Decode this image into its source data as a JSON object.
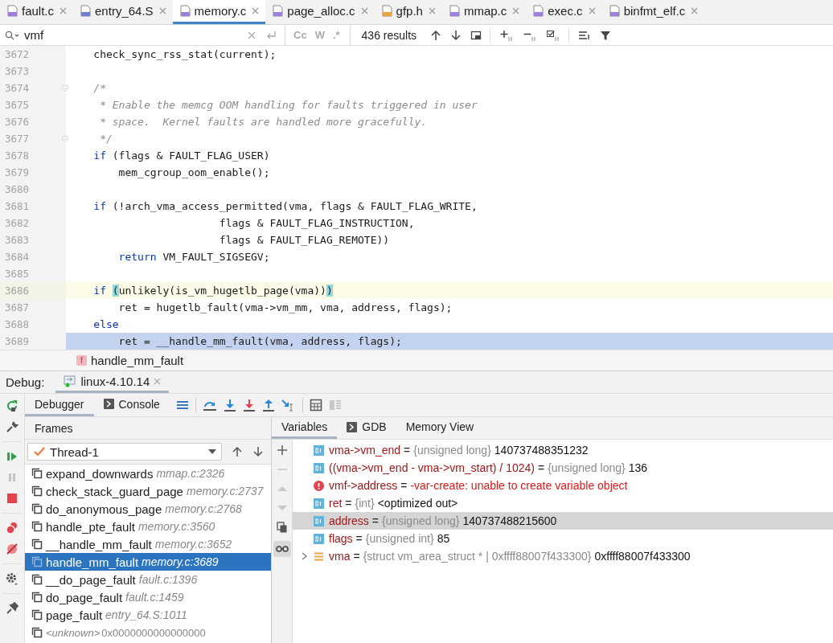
{
  "editor_tabs": [
    {
      "label": "fault.c",
      "kind": "c",
      "selected": false
    },
    {
      "label": "entry_64.S",
      "kind": "asm",
      "selected": false
    },
    {
      "label": "memory.c",
      "kind": "c",
      "selected": true
    },
    {
      "label": "page_alloc.c",
      "kind": "c",
      "selected": false
    },
    {
      "label": "gfp.h",
      "kind": "h",
      "selected": false
    },
    {
      "label": "mmap.c",
      "kind": "c",
      "selected": false
    },
    {
      "label": "exec.c",
      "kind": "c",
      "selected": false
    },
    {
      "label": "binfmt_elf.c",
      "kind": "c",
      "selected": false
    }
  ],
  "search": {
    "value": "vmf",
    "options": [
      {
        "label": "Cc",
        "selected": false
      },
      {
        "label": "W",
        "selected": false
      },
      {
        "label": ".*",
        "selected": false
      }
    ],
    "results": "436 results"
  },
  "code": {
    "lines": [
      {
        "number": "3672",
        "current": false,
        "executing": false,
        "segments": [
          {
            "kind": "plain",
            "text": "    check_sync_rss_stat(current);"
          }
        ]
      },
      {
        "number": "3673",
        "current": false,
        "executing": false
      },
      {
        "number": "3674",
        "current": false,
        "executing": false,
        "fold": true,
        "segments": [
          {
            "kind": "comment",
            "text": "    /*"
          }
        ]
      },
      {
        "number": "3675",
        "current": false,
        "executing": false,
        "segments": [
          {
            "kind": "comment",
            "text": "     * Enable the memcg OOM handling for faults triggered in user"
          }
        ]
      },
      {
        "number": "3676",
        "current": false,
        "executing": false,
        "segments": [
          {
            "kind": "comment",
            "text": "     * space.  Kernel faults are handled more gracefully."
          }
        ]
      },
      {
        "number": "3677",
        "current": false,
        "executing": false,
        "fold": true,
        "segments": [
          {
            "kind": "comment",
            "text": "     */"
          }
        ]
      },
      {
        "number": "3678",
        "current": false,
        "executing": false,
        "segments": [
          {
            "kind": "keyword",
            "text": "    if"
          },
          {
            "kind": "plain",
            "text": " (flags & FAULT_FLAG_USER)"
          }
        ]
      },
      {
        "number": "3679",
        "current": false,
        "executing": false,
        "segments": [
          {
            "kind": "plain",
            "text": "        mem_cgroup_oom_enable();"
          }
        ]
      },
      {
        "number": "3680",
        "current": false,
        "executing": false
      },
      {
        "number": "3681",
        "current": false,
        "executing": false,
        "segments": [
          {
            "kind": "keyword",
            "text": "    if"
          },
          {
            "kind": "plain",
            "text": " (!arch_vma_access_permitted(vma, flags & FAULT_FLAG_WRITE,"
          }
        ]
      },
      {
        "number": "3682",
        "current": false,
        "executing": false,
        "segments": [
          {
            "kind": "plain",
            "text": "                        flags & FAULT_FLAG_INSTRUCTION,"
          }
        ]
      },
      {
        "number": "3683",
        "current": false,
        "executing": false,
        "segments": [
          {
            "kind": "plain",
            "text": "                        flags & FAULT_FLAG_REMOTE))"
          }
        ]
      },
      {
        "number": "3684",
        "current": false,
        "executing": false,
        "segments": [
          {
            "kind": "keyword",
            "text": "        return"
          },
          {
            "kind": "plain",
            "text": " VM_FAULT_SIGSEGV;"
          }
        ]
      },
      {
        "number": "3685",
        "current": false,
        "executing": false
      },
      {
        "number": "3686",
        "current": true,
        "executing": false,
        "segments": [
          {
            "kind": "keyword",
            "text": "    if "
          },
          {
            "kind": "match",
            "text": "("
          },
          {
            "kind": "plain",
            "text": "unlikely(is_vm_hugetlb_page(vma))"
          },
          {
            "kind": "match",
            "text": ")"
          }
        ]
      },
      {
        "number": "3687",
        "current": false,
        "executing": false,
        "segments": [
          {
            "kind": "plain",
            "text": "        ret = hugetlb_fault(vma->vm_mm, vma, address, flags);"
          }
        ]
      },
      {
        "number": "3688",
        "current": false,
        "executing": false,
        "segments": [
          {
            "kind": "keyword",
            "text": "    else"
          }
        ]
      },
      {
        "number": "3689",
        "current": false,
        "executing": true,
        "segments": [
          {
            "kind": "plain",
            "text": "        ret = __handle_mm_fault(vma, address, flags);"
          }
        ]
      }
    ]
  },
  "breadcrumb": {
    "icon_letter": "f",
    "label": "handle_mm_fault"
  },
  "debug": {
    "label": "Debug:",
    "session": "linux-4.10.14",
    "tabs": [
      {
        "label": "Debugger",
        "selected": true
      },
      {
        "label": "Console",
        "selected": false
      }
    ],
    "frames": {
      "title": "Frames",
      "thread": "Thread-1",
      "items": [
        {
          "kind": "frame",
          "name": "expand_downwards",
          "location": "mmap.c:2326",
          "selected": false
        },
        {
          "kind": "frame",
          "name": "check_stack_guard_page",
          "location": "memory.c:2737",
          "selected": false
        },
        {
          "kind": "frame",
          "name": "do_anonymous_page",
          "location": "memory.c:2768",
          "selected": false
        },
        {
          "kind": "frame",
          "name": "handle_pte_fault",
          "location": "memory.c:3560",
          "selected": false
        },
        {
          "kind": "frame",
          "name": "__handle_mm_fault",
          "location": "memory.c:3652",
          "selected": false
        },
        {
          "kind": "frame",
          "name": "handle_mm_fault",
          "location": "memory.c:3689",
          "selected": true
        },
        {
          "kind": "frame",
          "name": "__do_page_fault",
          "location": "fault.c:1396",
          "selected": false
        },
        {
          "kind": "frame",
          "name": "do_page_fault",
          "location": "fault.c:1459",
          "selected": false
        },
        {
          "kind": "frame",
          "name": "page_fault",
          "location": "entry_64.S:1011",
          "selected": false
        },
        {
          "kind": "unknown",
          "name": "<unknown>",
          "location": "0x0000000000000000",
          "selected": false
        }
      ]
    },
    "variables": {
      "tabs": [
        {
          "label": "Variables",
          "selected": true
        },
        {
          "label": "GDB",
          "selected": false
        },
        {
          "label": "Memory View",
          "selected": false
        }
      ],
      "items": [
        {
          "kind": "value",
          "name": "vma->vm_end",
          "eq": "=",
          "type": "{unsigned long}",
          "value": "140737488351232",
          "selected": false
        },
        {
          "kind": "value",
          "name": "((vma->vm_end - vma->vm_start) / 1024)",
          "eq": "=",
          "type": "{unsigned long}",
          "value": "136",
          "selected": false
        },
        {
          "kind": "error",
          "name": "vmf->address",
          "eq": "=",
          "value": "-var-create: unable to create variable object",
          "selected": false
        },
        {
          "kind": "value",
          "name": "ret",
          "eq": "=",
          "type": "{int}",
          "value": "<optimized out>",
          "selected": false
        },
        {
          "kind": "value",
          "name": "address",
          "eq": "=",
          "type": "{unsigned long}",
          "value": "140737488215600",
          "selected": true
        },
        {
          "kind": "value",
          "name": "flags",
          "eq": "=",
          "type": "{unsigned int}",
          "value": "85",
          "selected": false
        },
        {
          "kind": "struct",
          "name": "vma",
          "eq": "=",
          "type": "{struct vm_area_struct * | 0xffff88007f433300}",
          "value": "0xffff88007f433300",
          "selected": false,
          "expanded": false
        }
      ]
    }
  }
}
